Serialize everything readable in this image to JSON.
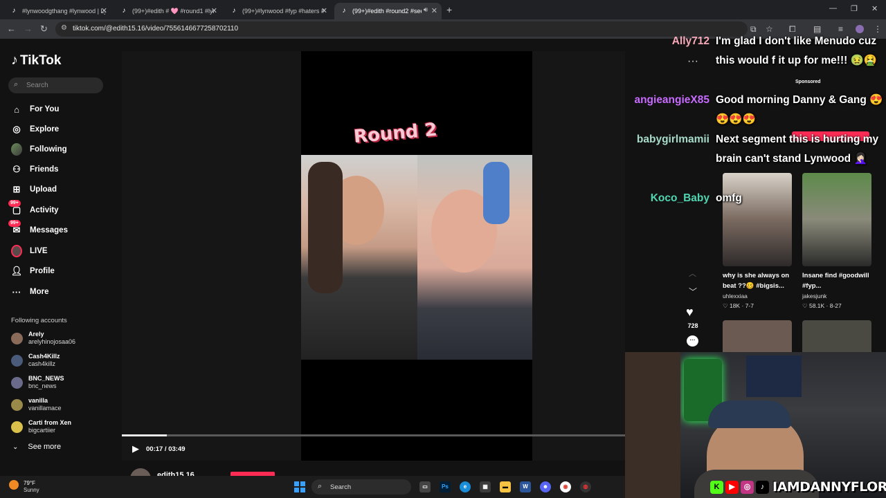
{
  "browser": {
    "tabs": [
      {
        "label": "#lynwoodgthang #lynwood | Ly"
      },
      {
        "label": "(99+)#edith # 🩷 #round1 #lyn"
      },
      {
        "label": "(99+)#lynwood #fyp #haters #"
      },
      {
        "label": "(99+)#edith #round2 #seer"
      }
    ],
    "url": "tiktok.com/@edith15.16/video/7556146677258702110"
  },
  "tiktok": {
    "logo": "TikTok",
    "search_placeholder": "Search",
    "nav": [
      {
        "label": "For You",
        "icon": "home-icon"
      },
      {
        "label": "Explore",
        "icon": "compass-icon"
      },
      {
        "label": "Following",
        "icon": "following-avatar-icon"
      },
      {
        "label": "Friends",
        "icon": "friends-icon"
      },
      {
        "label": "Upload",
        "icon": "upload-icon"
      },
      {
        "label": "Activity",
        "icon": "activity-icon",
        "badge": "99+"
      },
      {
        "label": "Messages",
        "icon": "messages-icon",
        "badge": "99+"
      },
      {
        "label": "LIVE",
        "icon": "live-icon"
      },
      {
        "label": "Profile",
        "icon": "profile-icon"
      },
      {
        "label": "More",
        "icon": "more-icon"
      }
    ],
    "following_title": "Following accounts",
    "accounts": [
      {
        "name": "Arely",
        "handle": "arelyhinojosaa06"
      },
      {
        "name": "Cash4Killz",
        "handle": "cash4killz"
      },
      {
        "name": "BNC_NEWS",
        "handle": "bnc_news"
      },
      {
        "name": "vanilla",
        "handle": "vanillamace"
      },
      {
        "name": "Carti from Xen",
        "handle": "bigcartiier"
      }
    ],
    "see_more": "See more"
  },
  "video": {
    "overlay_text": "Round 2",
    "likes": "728",
    "time": "00:17 / 03:49",
    "progress": 0.09,
    "author": "edith15.16"
  },
  "right_column": {
    "sponsored": "Sponsored",
    "videos": [
      {
        "caption": "why is she always on beat ??🥴 #bigsis...",
        "user": "uhlexxiaa",
        "stats": "♡ 18K · 7-7"
      },
      {
        "caption": "Insane find #goodwill #fyp...",
        "user": "jakesjunk",
        "stats": "♡ 58.1K · 8-27"
      }
    ]
  },
  "chat": [
    {
      "name": "Ally712",
      "color": "#f7a8b8",
      "message": "I'm glad I don't like Menudo cuz this would f it up for me!!! 🤢🤮"
    },
    {
      "name": "angieangieX85",
      "color": "#c76bff",
      "message": "Good morning Danny & Gang 😍😍😍😍"
    },
    {
      "name": "babygirlmamii",
      "color": "#a8dcc8",
      "message": "Next segment this is hurting my brain can't stand Lynwood 🤦🏻‍♀️"
    },
    {
      "name": "Koco_Baby",
      "color": "#4fd6b0",
      "message": "omfg"
    }
  ],
  "stream": {
    "streamer": "IAMDANNYFLORES"
  },
  "taskbar": {
    "temperature": "79°F",
    "weather": "Sunny",
    "search_label": "Search"
  }
}
